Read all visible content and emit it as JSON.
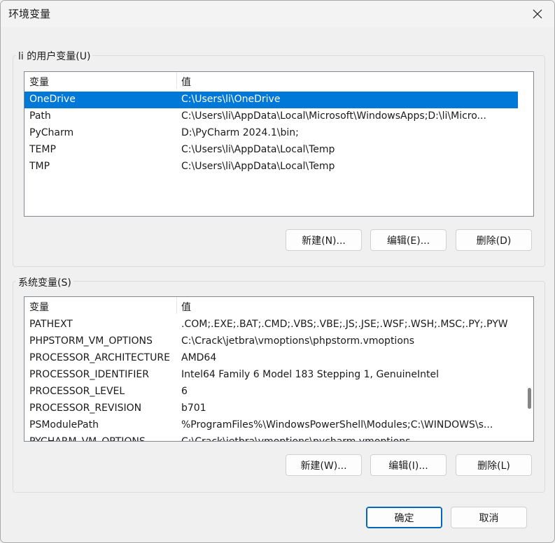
{
  "window": {
    "title": "环境变量"
  },
  "user_vars": {
    "label": "li 的用户变量(U)",
    "columns": [
      "变量",
      "值"
    ],
    "rows": [
      [
        "OneDrive",
        "C:\\Users\\li\\OneDrive"
      ],
      [
        "Path",
        "C:\\Users\\li\\AppData\\Local\\Microsoft\\WindowsApps;D:\\li\\Micro..."
      ],
      [
        "PyCharm",
        "D:\\PyCharm 2024.1\\bin;"
      ],
      [
        "TEMP",
        "C:\\Users\\li\\AppData\\Local\\Temp"
      ],
      [
        "TMP",
        "C:\\Users\\li\\AppData\\Local\\Temp"
      ]
    ],
    "selected_row": 0,
    "buttons": {
      "new": "新建(N)...",
      "edit": "编辑(E)...",
      "delete": "删除(D)"
    }
  },
  "system_vars": {
    "label": "系统变量(S)",
    "columns": [
      "变量",
      "值"
    ],
    "rows": [
      [
        "PATHEXT",
        ".COM;.EXE;.BAT;.CMD;.VBS;.VBE;.JS;.JSE;.WSF;.WSH;.MSC;.PY;.PYW"
      ],
      [
        "PHPSTORM_VM_OPTIONS",
        "C:\\Crack\\jetbra\\vmoptions\\phpstorm.vmoptions"
      ],
      [
        "PROCESSOR_ARCHITECTURE",
        "AMD64"
      ],
      [
        "PROCESSOR_IDENTIFIER",
        "Intel64 Family 6 Model 183 Stepping 1, GenuineIntel"
      ],
      [
        "PROCESSOR_LEVEL",
        "6"
      ],
      [
        "PROCESSOR_REVISION",
        "b701"
      ],
      [
        "PSModulePath",
        "%ProgramFiles%\\WindowsPowerShell\\Modules;C:\\WINDOWS\\s..."
      ],
      [
        "PYCHARM_VM_OPTIONS",
        "C:\\Crack\\jetbra\\vmoptions\\pycharm.vmoptions"
      ]
    ],
    "scroll_position": 0.75,
    "buttons": {
      "new": "新建(W)...",
      "edit": "编辑(I)...",
      "delete": "删除(L)"
    }
  },
  "footer": {
    "ok": "确定",
    "cancel": "取消"
  },
  "colors": {
    "selection": "#0078d7",
    "primary_border": "#0067c0"
  },
  "icons": {
    "close": "close-icon"
  }
}
